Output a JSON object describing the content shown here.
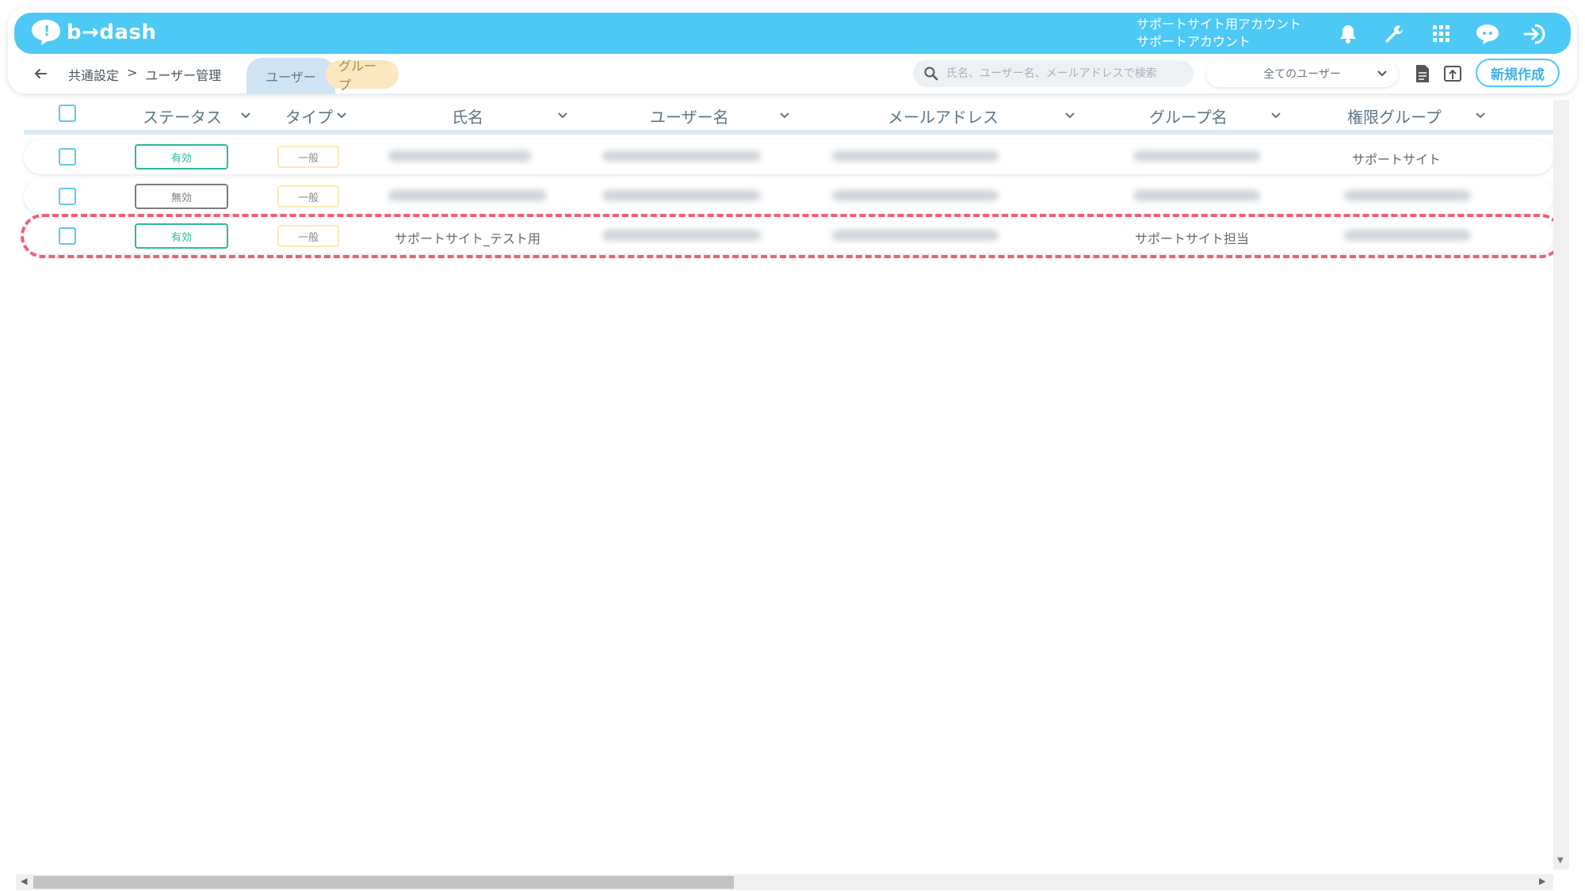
{
  "app": {
    "name": "b→dash"
  },
  "header": {
    "account_line1": "サポートサイト用アカウント",
    "account_line2": "サポートアカウント"
  },
  "breadcrumb": {
    "items": [
      "共通設定",
      ">",
      "ユーザー管理"
    ]
  },
  "tabs": [
    {
      "label": "ユーザー"
    },
    {
      "label": "グループ"
    }
  ],
  "search": {
    "placeholder": "氏名、ユーザー名、メールアドレスで検索"
  },
  "filter": {
    "selected": "全てのユーザー"
  },
  "actions": {
    "new_label": "新規作成"
  },
  "table": {
    "columns": [
      "ステータス",
      "タイプ",
      "氏名",
      "ユーザー名",
      "メールアドレス",
      "グループ名",
      "権限グループ"
    ],
    "rows": [
      {
        "status": "有効",
        "status_active": true,
        "type": "一般",
        "name": "",
        "username": "",
        "email": "",
        "group": "",
        "role": "サポートサイト"
      },
      {
        "status": "無効",
        "status_active": false,
        "type": "一般",
        "name": "",
        "username": "",
        "email": "",
        "group": "",
        "role": ""
      },
      {
        "status": "有効",
        "status_active": true,
        "type": "一般",
        "name": "サポートサイト_テスト用",
        "username": "",
        "email": "",
        "group": "サポートサイト担当",
        "role": ""
      }
    ]
  },
  "colors": {
    "brand": "#4dc9f6",
    "active": "#2db99a",
    "inactive": "#7d7d7d",
    "highlight": "#ef5f73"
  }
}
